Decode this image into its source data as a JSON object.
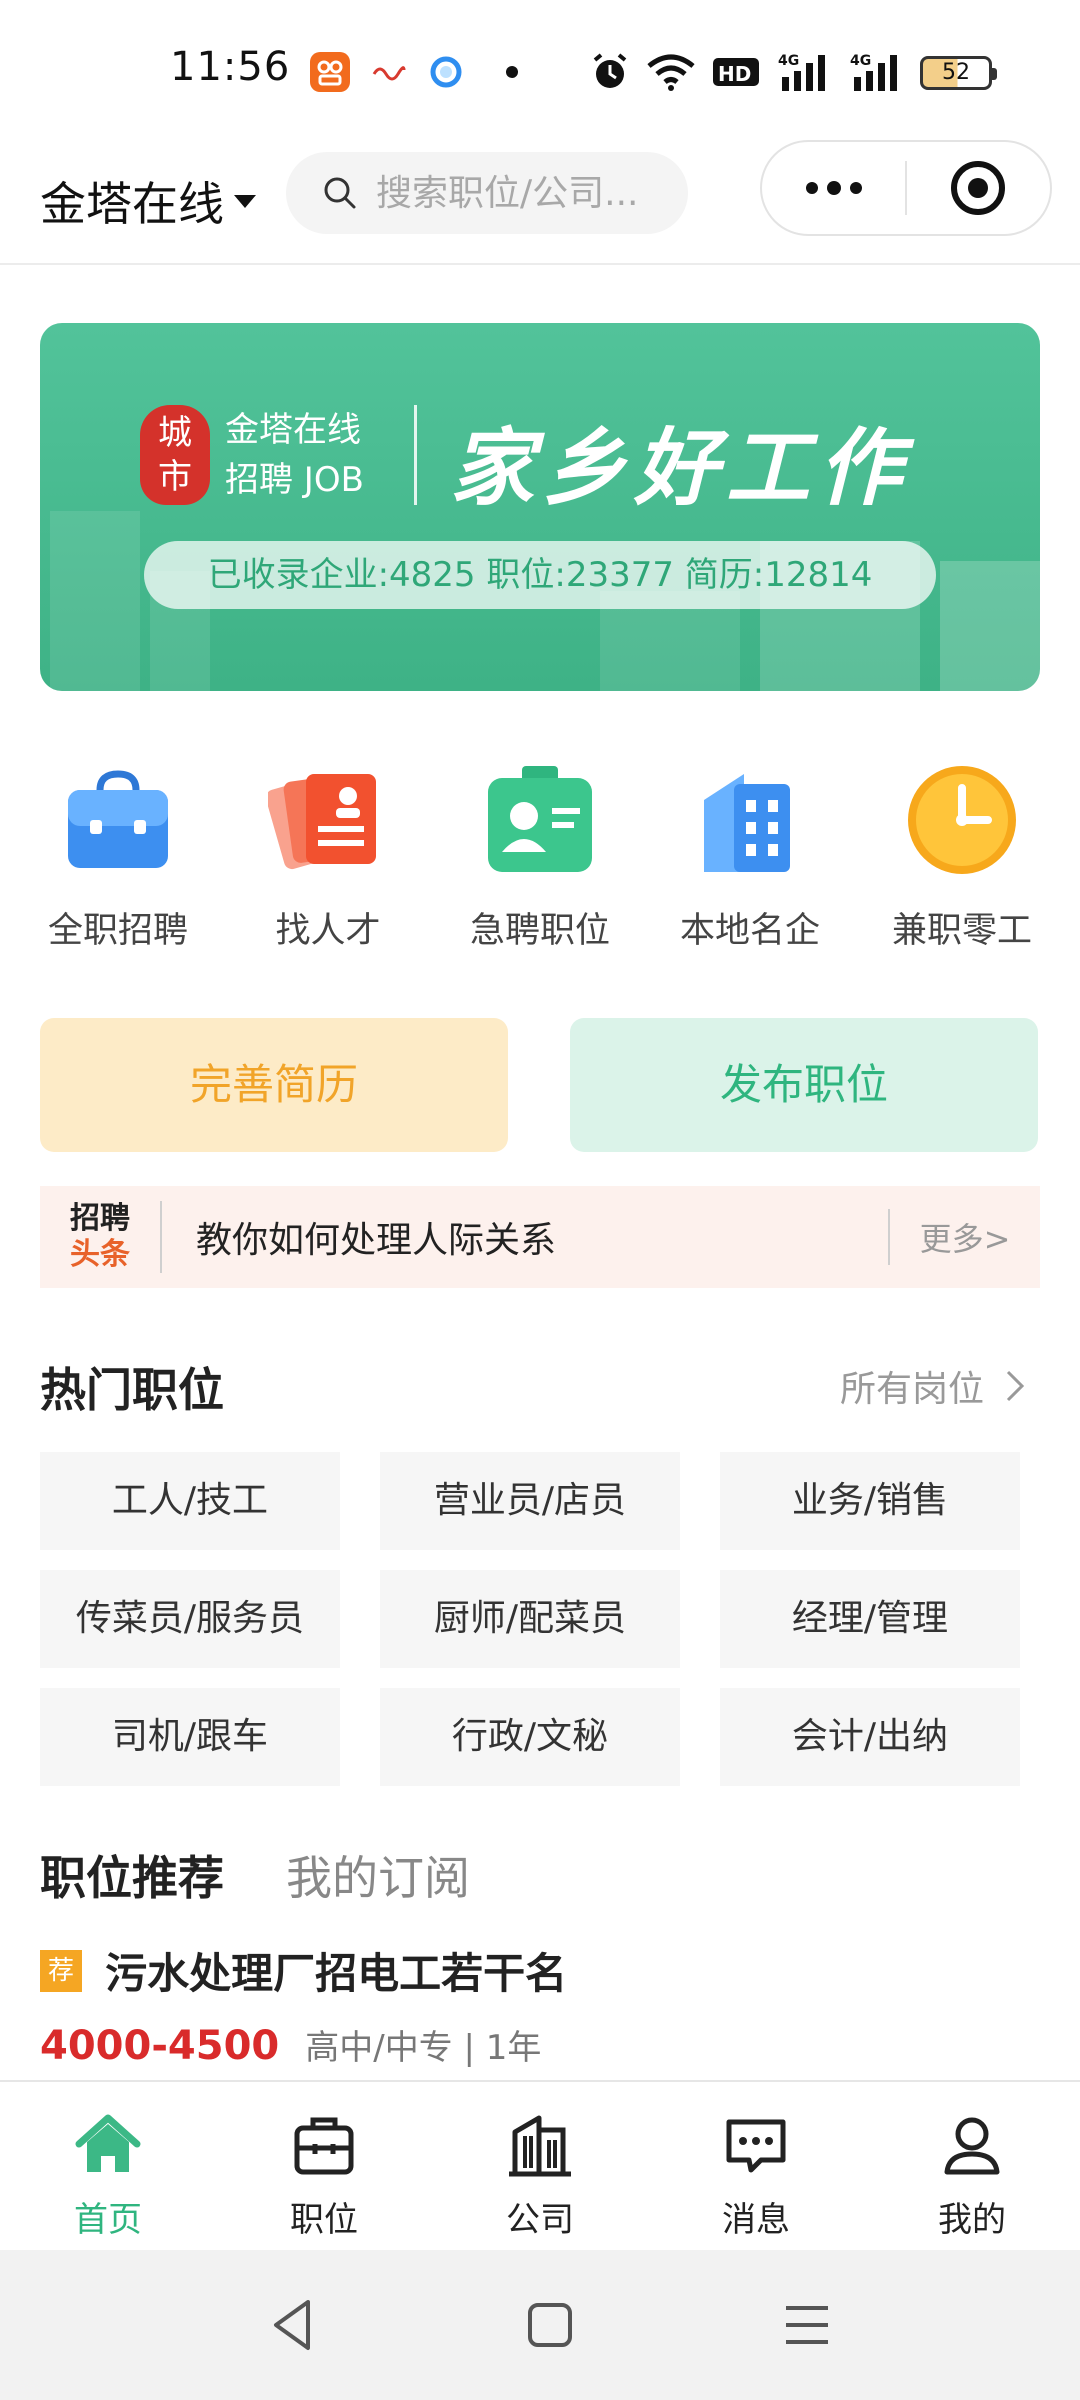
{
  "status_bar": {
    "time": "11:56",
    "battery": "52",
    "icons": [
      "app-notification-icon",
      "news-app-icon",
      "browser-app-icon",
      "alarm-icon",
      "wifi-icon",
      "hd-icon",
      "signal-4g-icon",
      "signal-4g-icon"
    ]
  },
  "header": {
    "city": "金塔在线",
    "search_placeholder": "搜索职位/公司...",
    "more_icon": "more-dots-icon",
    "close_icon": "target-circle-icon"
  },
  "banner": {
    "logo_char": "城\n市",
    "logo_line1": "金塔在线",
    "logo_line2": "招聘 JOB",
    "slogan": "家乡好工作",
    "stats": "已收录企业:4825 职位:23377 简历:12814"
  },
  "quick_nav": [
    {
      "label": "全职招聘",
      "icon": "briefcase-icon"
    },
    {
      "label": "找人才",
      "icon": "resume-cards-icon"
    },
    {
      "label": "急聘职位",
      "icon": "id-badge-icon"
    },
    {
      "label": "本地名企",
      "icon": "buildings-icon"
    },
    {
      "label": "兼职零工",
      "icon": "clock-icon"
    }
  ],
  "actions": {
    "resume": "完善简历",
    "post": "发布职位"
  },
  "headline": {
    "logo_top": "招聘",
    "logo_bottom": "头条",
    "text": "教你如何处理人际关系",
    "more": "更多>"
  },
  "hot_jobs": {
    "title": "热门职位",
    "all": "所有岗位",
    "items": [
      "工人/技工",
      "营业员/店员",
      "业务/销售",
      "传菜员/服务员",
      "厨师/配菜员",
      "经理/管理",
      "司机/跟车",
      "行政/文秘",
      "会计/出纳"
    ]
  },
  "recommend": {
    "tab_active": "职位推荐",
    "tab_other": "我的订阅",
    "job": {
      "tag": "荐",
      "title": "污水处理厂招电工若干名",
      "salary": "4000-4500",
      "requirements": "高中/中专 | 1年"
    }
  },
  "tabbar": [
    {
      "label": "首页",
      "icon": "home-icon",
      "active": true
    },
    {
      "label": "职位",
      "icon": "briefcase-outline-icon",
      "active": false
    },
    {
      "label": "公司",
      "icon": "building-outline-icon",
      "active": false
    },
    {
      "label": "消息",
      "icon": "message-icon",
      "active": false
    },
    {
      "label": "我的",
      "icon": "user-icon",
      "active": false
    }
  ],
  "colors": {
    "brand_green": "#2fb57f",
    "banner_green": "#4ac095",
    "salary_red": "#d92b2b",
    "resume_orange": "#f1a429"
  }
}
